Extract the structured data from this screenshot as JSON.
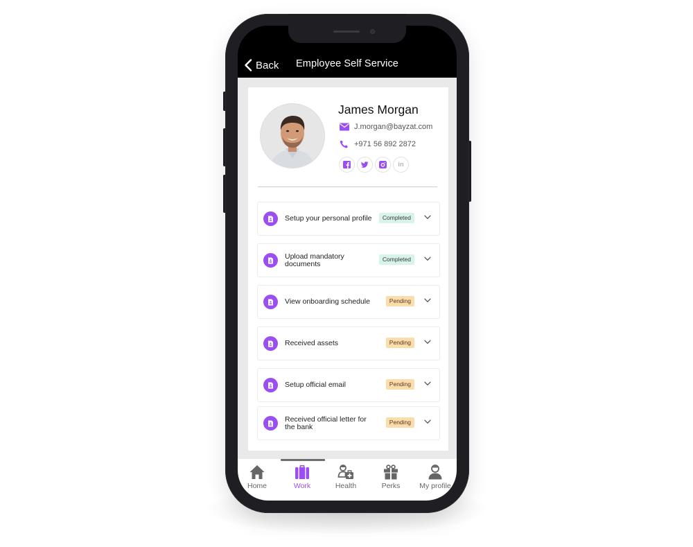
{
  "header": {
    "back_label": "Back",
    "title": "Employee Self Service"
  },
  "profile": {
    "name": "James Morgan",
    "email": "J.morgan@bayzat.com",
    "phone": "+971 56 892 2872",
    "socials": [
      {
        "icon": "facebook-icon",
        "label": "f"
      },
      {
        "icon": "twitter-icon",
        "label": ""
      },
      {
        "icon": "instagram-icon",
        "label": ""
      },
      {
        "icon": "linkedin-icon",
        "label": "in"
      }
    ]
  },
  "tasks": [
    {
      "label": "Setup your personal profile",
      "status": "Completed"
    },
    {
      "label": "Upload mandatory documents",
      "status": "Completed"
    },
    {
      "label": "View onboarding schedule",
      "status": "Pending"
    },
    {
      "label": "Received assets",
      "status": "Pending"
    },
    {
      "label": "Setup official email",
      "status": "Pending"
    },
    {
      "label": "Received official letter for the bank",
      "status": "Pending"
    }
  ],
  "tabbar": {
    "active": "Work",
    "items": [
      {
        "label": "Home",
        "icon": "home-icon"
      },
      {
        "label": "Work",
        "icon": "briefcase-icon"
      },
      {
        "label": "Health",
        "icon": "doctor-kit-icon"
      },
      {
        "label": "Perks",
        "icon": "gift-icon"
      },
      {
        "label": "My profile",
        "icon": "user-icon"
      }
    ]
  },
  "colors": {
    "accent": "#9b4ff0",
    "completed_bg": "#d7f3ea",
    "pending_bg": "#fbdcab",
    "header_bg": "#000000",
    "content_bg": "#e9e9e9"
  }
}
